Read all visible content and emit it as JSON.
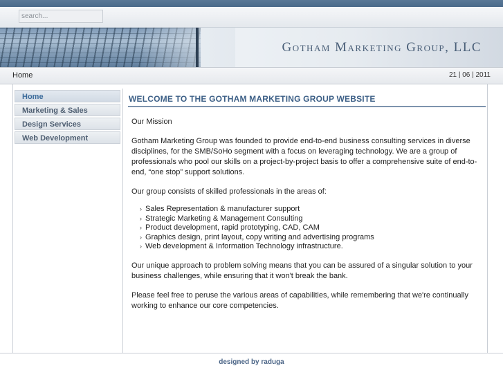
{
  "search": {
    "placeholder": "search..."
  },
  "header": {
    "title": "Gotham Marketing Group, LLC"
  },
  "breadcrumb": {
    "label": "Home"
  },
  "date": {
    "text": "21 | 06 | 2011"
  },
  "sidebar": {
    "items": [
      {
        "label": "Home",
        "active": true
      },
      {
        "label": "Marketing & Sales",
        "active": false
      },
      {
        "label": "Design Services",
        "active": false
      },
      {
        "label": "Web Development",
        "active": false
      }
    ]
  },
  "main": {
    "title": "WELCOME TO THE GOTHAM MARKETING GROUP WEBSITE",
    "mission_heading": "Our Mission",
    "intro": "Gotham Marketing Group was founded to provide end-to-end business consulting services in diverse disciplines, for the SMB/SoHo segment with a focus on leveraging technology. We are a group of professionals who pool our skills on a project-by-project basis to offer a comprehensive suite of end-to-end, “one stop” support solutions.",
    "group_intro": "Our group consists of skilled professionals in the areas of:",
    "services": [
      "Sales Representation & manufacturer support",
      "Strategic Marketing & Management Consulting",
      "Product development, rapid prototyping, CAD, CAM",
      "Graphics design, print layout, copy writing and advertising programs",
      "Web development & Information Technology infrastructure."
    ],
    "approach": "Our unique approach to problem solving means that you can be assured of a singular solution to your business challenges, while ensuring that it won't break the bank.",
    "closing": "Please feel free to peruse the various areas of capabilities, while remembering that we're continually working to enhance our core competencies."
  },
  "footer": {
    "text": "designed by raduga"
  },
  "colors": {
    "accent": "#3c5f86",
    "nav_text": "#4f5f72",
    "top_bar": "#4a6a8a"
  },
  "icons": {
    "bullet": "chevron-right-icon"
  }
}
